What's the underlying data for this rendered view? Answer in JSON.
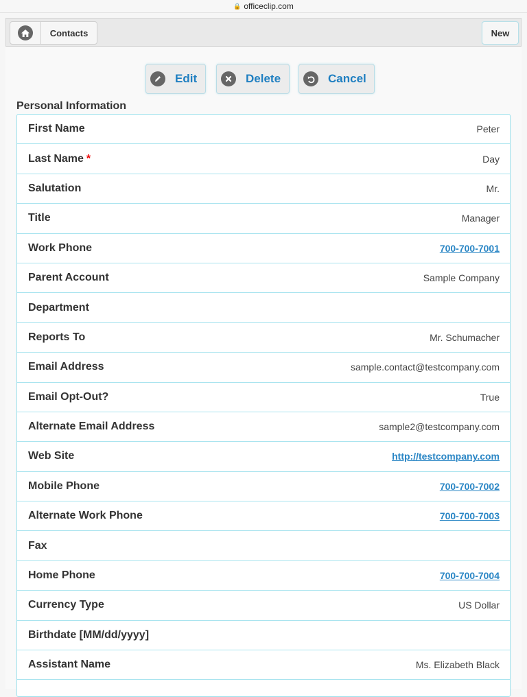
{
  "browser": {
    "url": "officeclip.com"
  },
  "header": {
    "breadcrumb": "Contacts",
    "new_label": "New"
  },
  "actions": {
    "edit": "Edit",
    "delete": "Delete",
    "cancel": "Cancel"
  },
  "section": {
    "title": "Personal Information"
  },
  "fields": [
    {
      "label": "First Name",
      "value": "Peter",
      "required": false,
      "link": false
    },
    {
      "label": "Last Name",
      "value": "Day",
      "required": true,
      "link": false
    },
    {
      "label": "Salutation",
      "value": "Mr.",
      "required": false,
      "link": false
    },
    {
      "label": "Title",
      "value": "Manager",
      "required": false,
      "link": false
    },
    {
      "label": "Work Phone",
      "value": "700-700-7001",
      "required": false,
      "link": true
    },
    {
      "label": "Parent Account",
      "value": "Sample Company",
      "required": false,
      "link": false
    },
    {
      "label": "Department",
      "value": "",
      "required": false,
      "link": false
    },
    {
      "label": "Reports To",
      "value": "Mr. Schumacher",
      "required": false,
      "link": false
    },
    {
      "label": "Email Address",
      "value": "sample.contact@testcompany.com",
      "required": false,
      "link": false
    },
    {
      "label": "Email Opt-Out?",
      "value": "True",
      "required": false,
      "link": false
    },
    {
      "label": "Alternate Email Address",
      "value": "sample2@testcompany.com",
      "required": false,
      "link": false
    },
    {
      "label": "Web Site",
      "value": "http://testcompany.com",
      "required": false,
      "link": true
    },
    {
      "label": "Mobile Phone",
      "value": "700-700-7002",
      "required": false,
      "link": true
    },
    {
      "label": "Alternate Work Phone",
      "value": "700-700-7003",
      "required": false,
      "link": true
    },
    {
      "label": "Fax",
      "value": "",
      "required": false,
      "link": false
    },
    {
      "label": "Home Phone",
      "value": "700-700-7004",
      "required": false,
      "link": true
    },
    {
      "label": "Currency Type",
      "value": "US Dollar",
      "required": false,
      "link": false
    },
    {
      "label": "Birthdate [MM/dd/yyyy]",
      "value": "",
      "required": false,
      "link": false
    },
    {
      "label": "Assistant Name",
      "value": "Ms. Elizabeth Black",
      "required": false,
      "link": false
    }
  ]
}
